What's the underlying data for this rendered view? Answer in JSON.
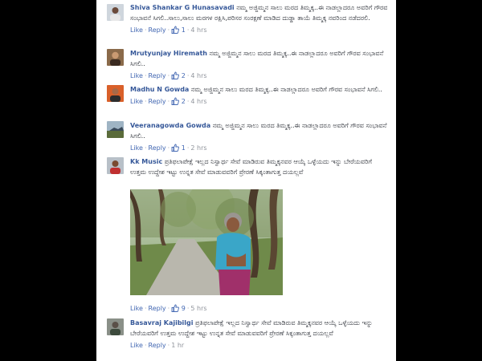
{
  "comments": [
    {
      "author": "Shiva Shankar G Hunasavadi",
      "text": " ನಮ್ಮ ಅಜ್ಜಿಮ್ಮನ ಸಾಲು ಮರದ ತಿಮ್ಮಕ್ಕ..ಈ ನಾಡಲ್ಲಾದರೂ ಅವರಿಗೆ ಗೌರವ ಸಂಭಾವನೆ ಸಿಗಲಿ..ಸಾಲು,ಸಾಲು ಮರಗಳ ರಕ್ಷಿಸಿ,ಪರಿಸರ ಸಂರಕ್ಷಣೆ ಮಾಡಿದ ದುಡ್ಡಾ ತಾಯೆ ತಿಮ್ಮಕ್ಕ ನವರಿಂದ ನಡೆದರಲಿ.",
      "like": "Like",
      "reply": "Reply",
      "likes": "1",
      "time": "4 hrs"
    },
    {
      "author": "Mrutyunjay Hiremath",
      "text": " ನಮ್ಮ ಅಜ್ಜಿಮ್ಮನ ಸಾಲು ಮರದ ತಿಮ್ಮಕ್ಕ..ಈ ನಾಡಲ್ಲಾದರೂ ಅವರಿಗೆ ಗೌರವ ಸಂಭಾವನೆ ಸಿಗಲಿ..",
      "like": "Like",
      "reply": "Reply",
      "likes": "2",
      "time": "4 hrs"
    },
    {
      "author": "Madhu N Gowda",
      "text": " ನಮ್ಮ ಅಜ್ಜಿಮ್ಮನ ಸಾಲು ಮರದ ತಿಮ್ಮಕ್ಕ..ಈ ನಾಡಲ್ಲಾದರೂ ಅವರಿಗೆ ಗೌರವ ಸಂಭಾವನೆ ಸಿಗಲಿ..",
      "like": "Like",
      "reply": "Reply",
      "likes": "2",
      "time": "4 hrs"
    },
    {
      "author": "Veeranagowda Gowda",
      "text": " ನಮ್ಮ ಅಜ್ಜಿಮ್ಮನ ಸಾಲು ಮರದ ತಿಮ್ಮಕ್ಕ..ಈ ನಾಡಲ್ಲಾದರೂ ಅವರಿಗೆ ಗೌರವ ಸಂಭಾವನೆ ಸಿಗಲಿ..",
      "like": "Like",
      "reply": "Reply",
      "likes": "1",
      "time": "2 hrs"
    },
    {
      "author": "Kk Music",
      "text": " ಪ್ರತಿಫಲಾಪೇಕ್ಷೆ ಇಲ್ಲದ ನಿಸ್ವಾರ್ಥ ಸೇವೆ ಮಾಡಿರುವ ತಿಮ್ಮಕ್ಕನವರ ಆಯ್ಕೆ ಒಳ್ಳೆಯದು ಇನ್ನು ಬೇರೆಯವರಿಗೆ ಉತ್ತಮ ಉದ್ದೇಶ ಇಟ್ಟು ಉನ್ನತ ಸೇವೆ ಮಾಡುವವರಿಗೆ ಪ್ರೇರಣೆ ಸಿಕ್ಕಂತಾಗುತ್ತ ದಯಲ್ಲವೆ",
      "like": "Like",
      "reply": "Reply",
      "likes": "9",
      "time": "5 hrs"
    },
    {
      "author": "Basavraj Kajibilgi",
      "text": " ಪ್ರತಿಫಲಾಪೇಕ್ಷೆ ಇಲ್ಲದ ನಿಸ್ವಾರ್ಥ ಸೇವೆ ಮಾಡಿರುವ ತಿಮ್ಮಕ್ಕನವರ ಆಯ್ಕೆ ಒಳ್ಳೆಯದು ಇನ್ನು ಬೇರೆಯವರಿಗೆ ಉತ್ತಮ ಉದ್ದೇಶ ಇಟ್ಟು ಉನ್ನತ ಸೇವೆ ಮಾಡುವವರಿಗೆ ಪ್ರೇರಣೆ ಸಿಕ್ಕಂತಾಗುತ್ತ ದಯಲ್ಲವೆ",
      "like": "Like",
      "reply": "Reply",
      "likes": "",
      "time": "1 hr"
    }
  ],
  "colors": {
    "link": "#4267b2",
    "author": "#365899",
    "meta": "#90949c"
  },
  "icons": {
    "like": "thumbs-up-icon"
  }
}
